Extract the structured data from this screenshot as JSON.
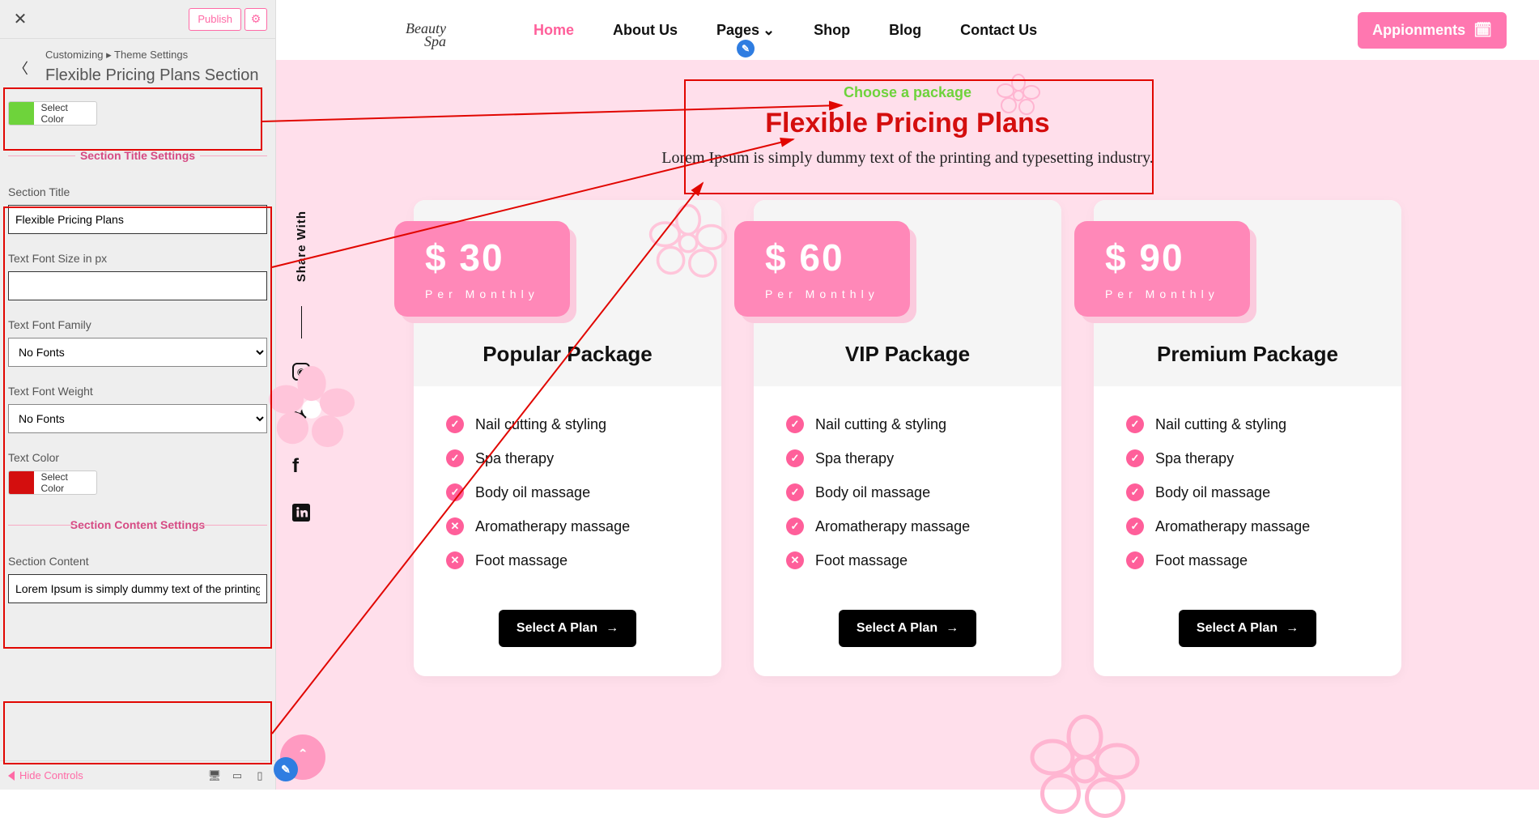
{
  "customizer": {
    "publish": "Publish",
    "crumb": "Customizing  ▸  Theme Settings",
    "title": "Flexible Pricing Plans Section",
    "select_color": "Select Color",
    "div_title_settings": "Section Title Settings",
    "lbl_section_title": "Section Title",
    "val_section_title": "Flexible Pricing Plans",
    "lbl_font_size": "Text Font Size in px",
    "val_font_size": "",
    "lbl_font_family": "Text Font Family",
    "val_font_family": "No Fonts",
    "lbl_font_weight": "Text Font Weight",
    "val_font_weight": "No Fonts",
    "lbl_text_color": "Text Color",
    "div_content_settings": "Section Content Settings",
    "lbl_section_content": "Section Content",
    "val_section_content": "Lorem Ipsum is simply dummy text of the printing",
    "hide_controls": "Hide Controls"
  },
  "nav": {
    "logo_top": "Beauty",
    "logo_sub": "Spa",
    "links": {
      "home": "Home",
      "about": "About Us",
      "pages": "Pages",
      "shop": "Shop",
      "blog": "Blog",
      "contact": "Contact Us"
    },
    "appoint": "Appionments"
  },
  "share": {
    "label": "Share With"
  },
  "section": {
    "subtitle": "Choose a package",
    "title": "Flexible Pricing Plans",
    "content": "Lorem Ipsum is simply dummy text of the printing and typesetting industry."
  },
  "plans": [
    {
      "price": "$ 30",
      "period": "Per Monthly",
      "name": "Popular Package",
      "features": [
        {
          "t": "Nail cutting & styling",
          "inc": true
        },
        {
          "t": "Spa therapy",
          "inc": true
        },
        {
          "t": "Body oil massage",
          "inc": true
        },
        {
          "t": "Aromatherapy massage",
          "inc": false
        },
        {
          "t": "Foot massage",
          "inc": false
        }
      ],
      "cta": "Select A Plan"
    },
    {
      "price": "$ 60",
      "period": "Per Monthly",
      "name": "VIP Package",
      "features": [
        {
          "t": "Nail cutting & styling",
          "inc": true
        },
        {
          "t": "Spa therapy",
          "inc": true
        },
        {
          "t": "Body oil massage",
          "inc": true
        },
        {
          "t": "Aromatherapy massage",
          "inc": true
        },
        {
          "t": "Foot massage",
          "inc": false
        }
      ],
      "cta": "Select A Plan"
    },
    {
      "price": "$ 90",
      "period": "Per Monthly",
      "name": "Premium Package",
      "features": [
        {
          "t": "Nail cutting & styling",
          "inc": true
        },
        {
          "t": "Spa therapy",
          "inc": true
        },
        {
          "t": "Body oil massage",
          "inc": true
        },
        {
          "t": "Aromatherapy massage",
          "inc": true
        },
        {
          "t": "Foot massage",
          "inc": true
        }
      ],
      "cta": "Select A Plan"
    }
  ]
}
